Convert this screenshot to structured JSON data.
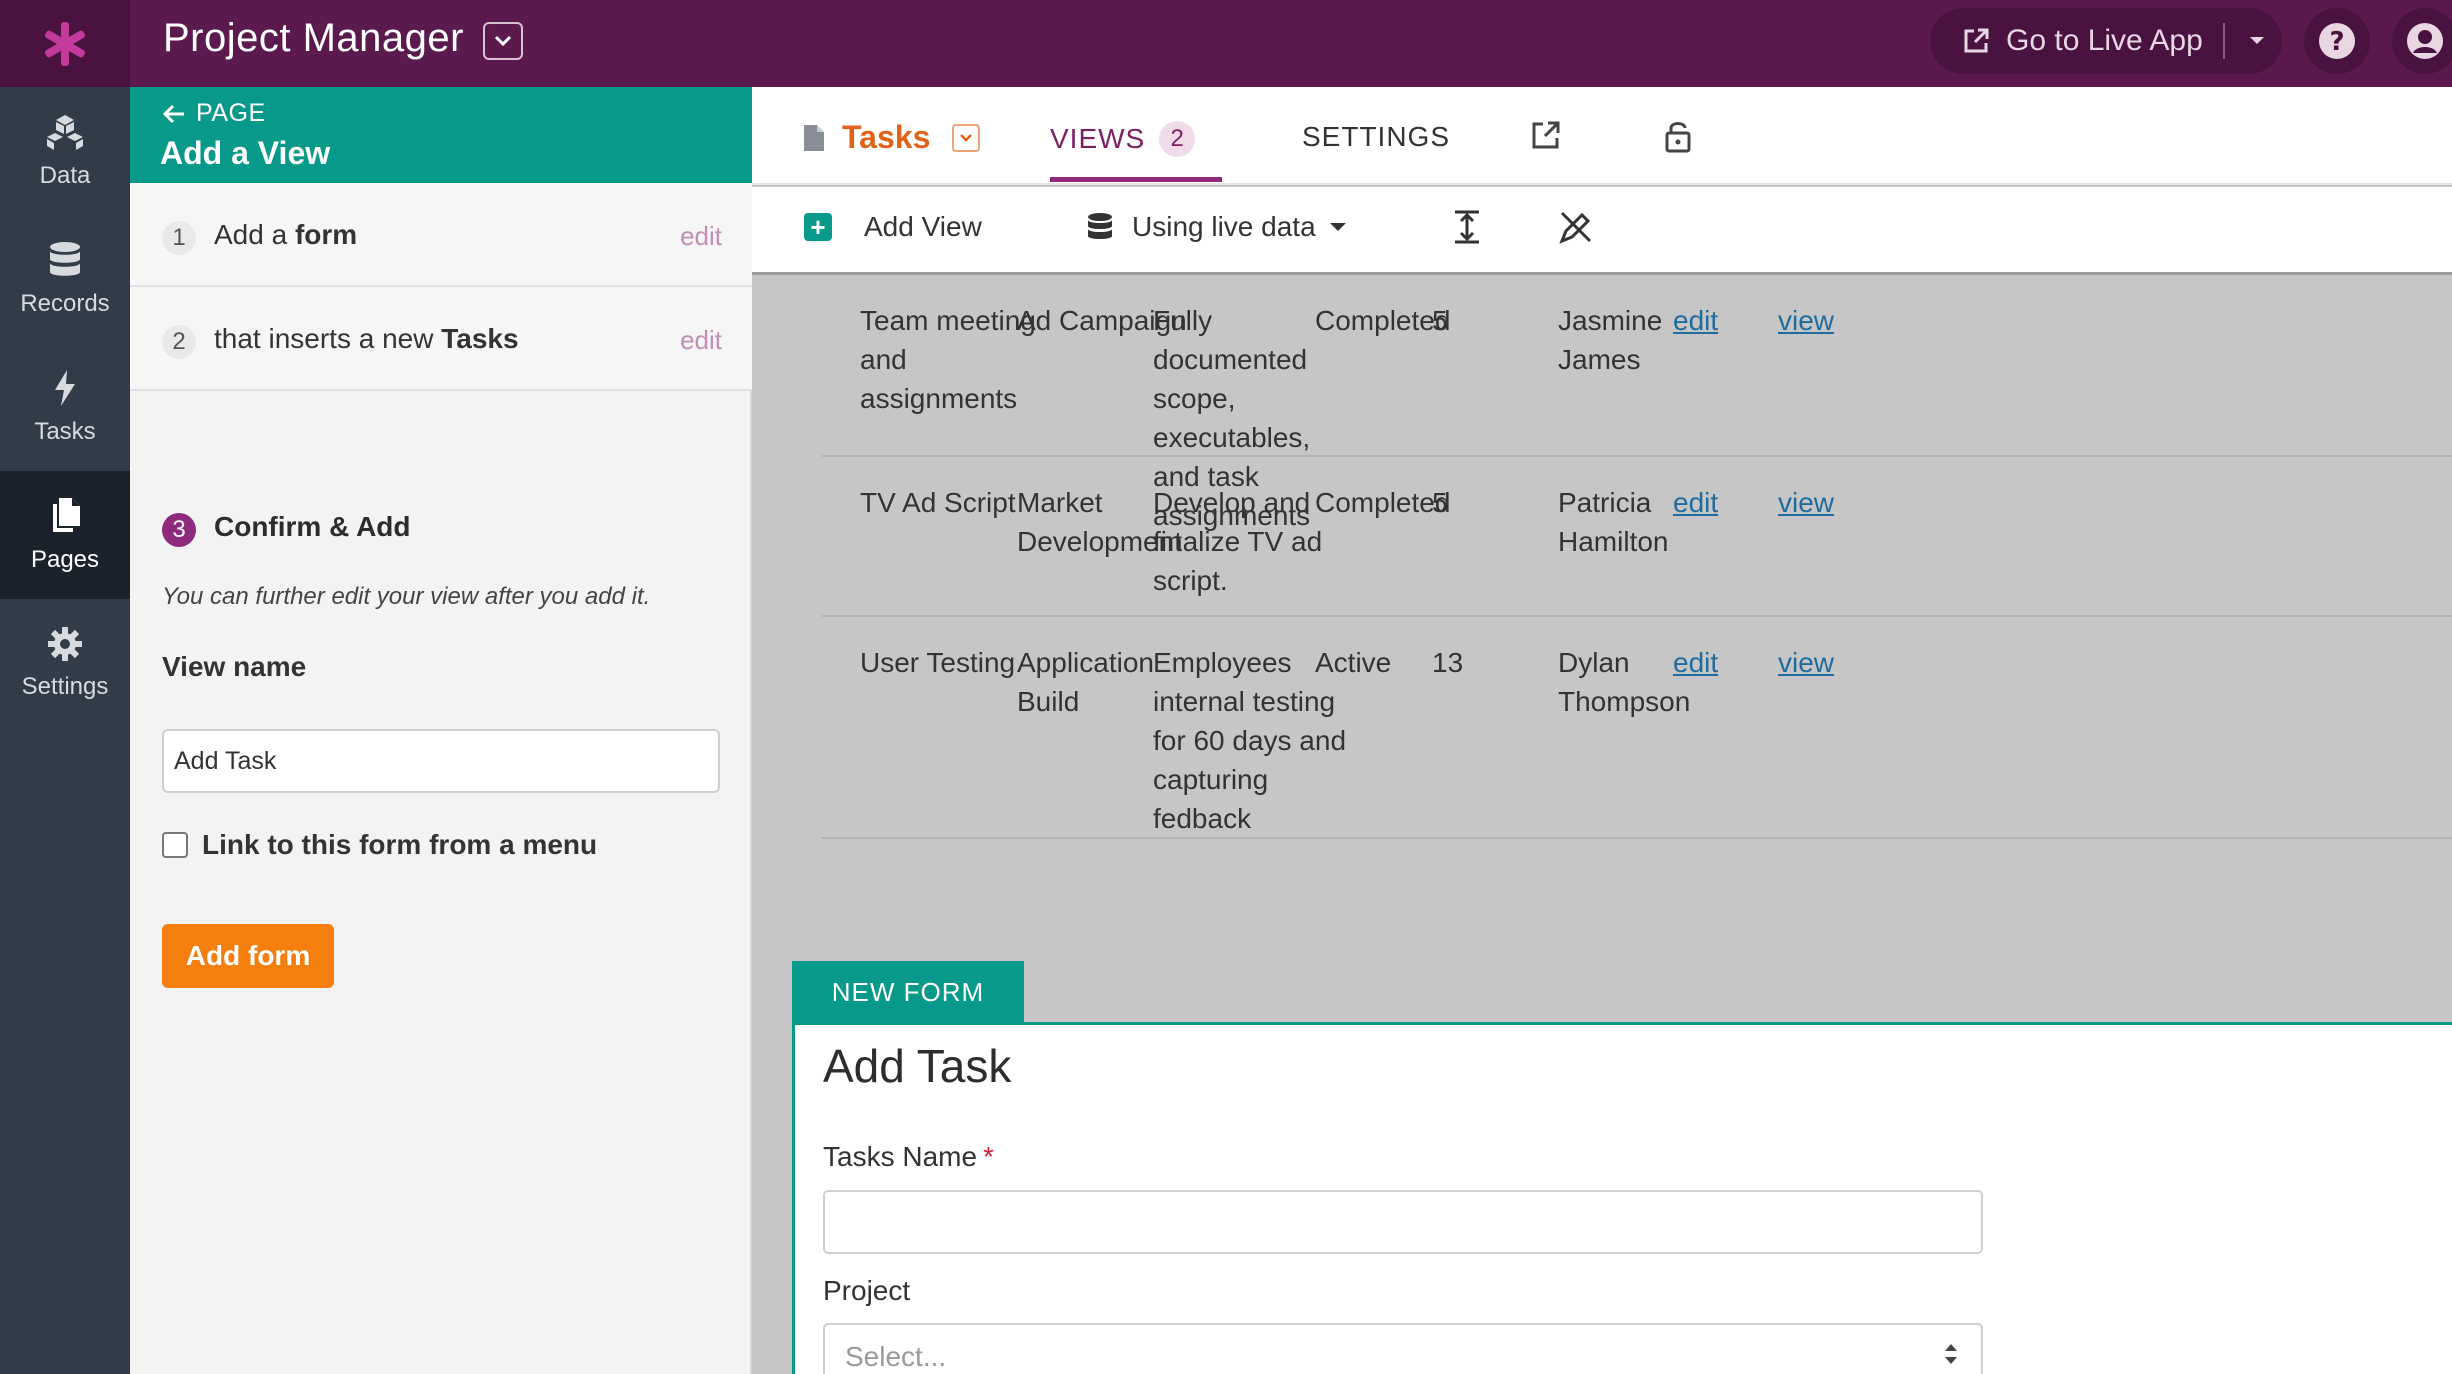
{
  "header": {
    "app_title": "Project Manager",
    "live_app_label": "Go to Live App"
  },
  "nav": {
    "items": [
      {
        "label": "Data",
        "icon": "cubes-icon"
      },
      {
        "label": "Records",
        "icon": "database-icon"
      },
      {
        "label": "Tasks",
        "icon": "bolt-icon"
      },
      {
        "label": "Pages",
        "icon": "pages-icon"
      },
      {
        "label": "Settings",
        "icon": "gear-icon"
      }
    ],
    "active": "Pages"
  },
  "builder": {
    "back_label": "PAGE",
    "title": "Add a View",
    "steps": [
      {
        "num": "1",
        "text_before": "Add a ",
        "text_bold": "form",
        "edit": "edit"
      },
      {
        "num": "2",
        "text_before": "that inserts a new ",
        "text_bold": "Tasks",
        "edit": "edit"
      }
    ],
    "step3": {
      "num": "3",
      "label": "Confirm & Add"
    },
    "hint": "You can further edit your view after you add it.",
    "view_name_label": "View name",
    "view_name_value": "Add Task",
    "menu_link_label": "Link to this form from a menu",
    "add_form_label": "Add form"
  },
  "tabs": {
    "tasks_label": "Tasks",
    "views_label": "VIEWS",
    "views_count": "2",
    "settings_label": "SETTINGS"
  },
  "toolbar": {
    "add_view_label": "Add View",
    "live_data_label": "Using live data"
  },
  "table": {
    "rows": [
      {
        "name": [
          "Team meeting",
          "and",
          "assignments"
        ],
        "project": [
          "Ad Campaign"
        ],
        "description": [
          "Fully",
          "documented",
          "scope,",
          "executables,",
          "and task",
          "assignments"
        ],
        "status": "Completed",
        "number": "5",
        "person": [
          "Jasmine",
          "James"
        ],
        "edit": "edit",
        "view": "view"
      },
      {
        "name": [
          "TV Ad Script"
        ],
        "project": [
          "Market",
          "Development"
        ],
        "description": [
          "Develop and",
          "finalize TV ad",
          "script."
        ],
        "status": "Completed",
        "number": "5",
        "person": [
          "Patricia",
          "Hamilton"
        ],
        "edit": "edit",
        "view": "view"
      },
      {
        "name": [
          "User Testing"
        ],
        "project": [
          "Application",
          "Build"
        ],
        "description": [
          "Employees",
          "internal testing",
          "for 60 days and",
          "capturing",
          "fedback"
        ],
        "status": "Active",
        "number": "13",
        "person": [
          "Dylan",
          "Thompson"
        ],
        "edit": "edit",
        "view": "view"
      }
    ]
  },
  "new_form": {
    "tag": "NEW FORM",
    "title": "Add Task",
    "tasks_name_label": "Tasks Name",
    "required_mark": "*",
    "project_label": "Project",
    "project_placeholder": "Select..."
  },
  "colors": {
    "header_bg": "#5b1a4d",
    "accent_teal": "#07998a",
    "accent_orange": "#f57f0e",
    "tasks_orange": "#e0631a",
    "views_purple": "#7a1f64",
    "link_blue": "#1f6c9e"
  }
}
